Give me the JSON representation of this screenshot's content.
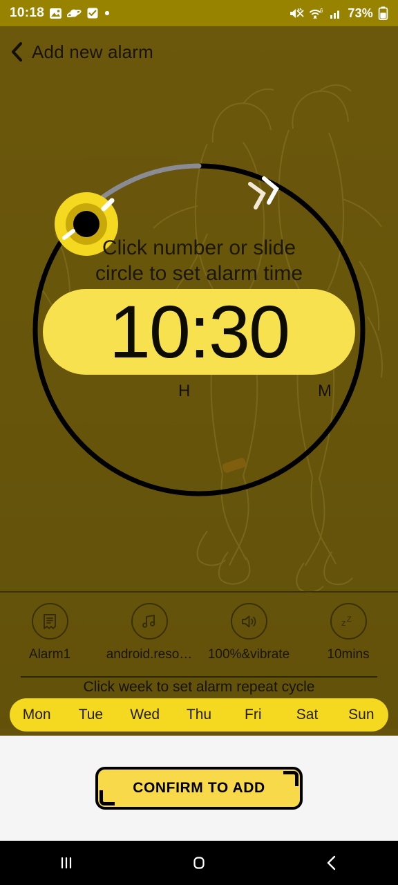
{
  "status_bar": {
    "clock": "10:18",
    "battery_percent": "73%",
    "left_icons": [
      "photos-icon",
      "saturn-icon",
      "checkbox-icon",
      "dot-icon"
    ],
    "right_icons": [
      "mute-icon",
      "wifi-icon",
      "signal-icon",
      "battery-icon"
    ],
    "background_color": "#988300"
  },
  "app_bar": {
    "back_icon": "chevron-left-icon",
    "title": "Add new alarm"
  },
  "dial": {
    "hint_line1": "Click number or slide",
    "hint_line2": "circle to set alarm time",
    "time": "10:30",
    "hour_label": "H",
    "minute_label": "M",
    "track_color": "#000000",
    "progress_color": "#8A8C92",
    "knob_outer_color": "#F5D820",
    "knob_ring_color": "#C9A90A",
    "knob_center_color": "#000000",
    "arrow_icon": "double-chevron-clockwise-icon",
    "pill_color": "#F7E14F"
  },
  "options": [
    {
      "icon": "note-icon",
      "label": "Alarm1"
    },
    {
      "icon": "music-icon",
      "label": "android.reso…"
    },
    {
      "icon": "volume-icon",
      "label": "100%&vibrate"
    },
    {
      "icon": "snooze-icon",
      "label": "10mins"
    }
  ],
  "week": {
    "hint": "Click week to set alarm repeat cycle",
    "days": [
      "Mon",
      "Tue",
      "Wed",
      "Thu",
      "Fri",
      "Sat",
      "Sun"
    ],
    "pill_color": "#F5D820"
  },
  "footer": {
    "confirm_label": "CONFIRM TO ADD",
    "button_color": "#F7D94A",
    "background_color": "#F5F5F5"
  },
  "nav_bar": {
    "recents_icon": "recents-icon",
    "home_icon": "home-icon",
    "back_icon": "back-icon"
  },
  "theme": {
    "page_background": "#65530B",
    "accent_yellow": "#F5D820",
    "text_dark": "#181400"
  }
}
